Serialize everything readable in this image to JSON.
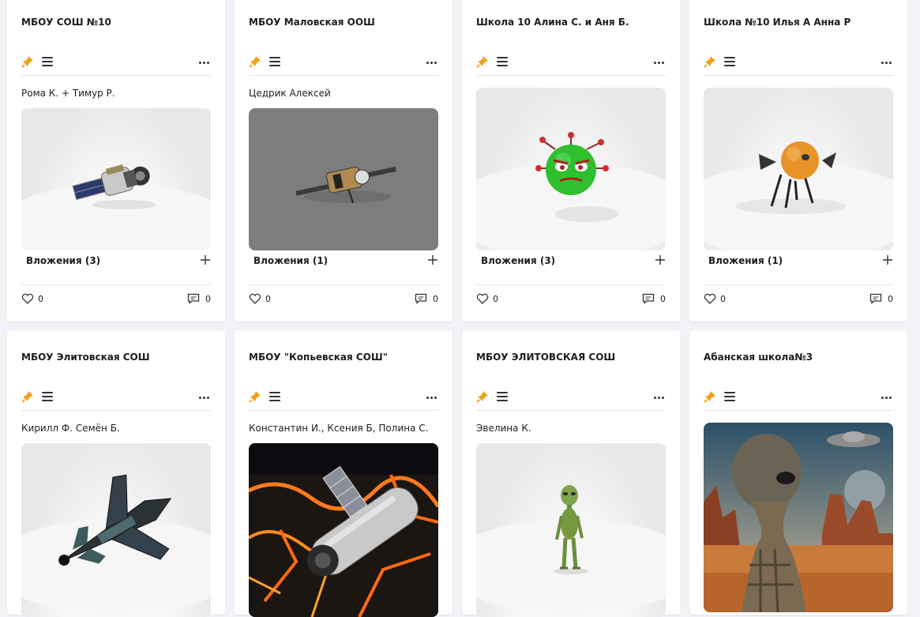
{
  "cards": [
    {
      "title": "МБОУ СОШ №10",
      "author": "Рома К. + Тимур Р.",
      "image": "satellite-model",
      "attachments": "Вложения (3)",
      "likes": "0",
      "comments": "0"
    },
    {
      "title": "МБОУ Маловская ООШ",
      "author": "Цедрик Алексей",
      "image": "satellite-model",
      "attachments": "Вложения (1)",
      "likes": "0",
      "comments": "0"
    },
    {
      "title": "Школа 10 Алина С. и Аня Б.",
      "author": "",
      "image": "green-virus-character-model",
      "attachments": "Вложения (3)",
      "likes": "0",
      "comments": "0"
    },
    {
      "title": "Школа №10 Илья А Анна Р",
      "author": "",
      "image": "orange-probe-model",
      "attachments": "Вложения (1)",
      "likes": "0",
      "comments": "0"
    },
    {
      "title": "МБОУ Элитовская СОШ",
      "author": "Кирилл Ф. Семён Б.",
      "image": "spaceship-model"
    },
    {
      "title": "МБОУ \"Копьевская СОШ\"",
      "author": "Константин И., Ксения Б, Полина С.",
      "image": "space-station-over-lava-image"
    },
    {
      "title": "МБОУ ЭЛИТОВСКАЯ СОШ",
      "author": "Эвелина К.",
      "image": "alien-figure-model"
    },
    {
      "title": "Абанская школа№3",
      "author": "",
      "image": "alien-desert-image"
    }
  ],
  "colors": {
    "background": "#f2f1f6",
    "card": "#ffffff",
    "pin": "#f0a21a",
    "divider": "#e3e3ea"
  },
  "icons": [
    "pin-icon",
    "menu-icon",
    "more-icon",
    "plus-icon",
    "heart-icon",
    "comment-icon"
  ]
}
